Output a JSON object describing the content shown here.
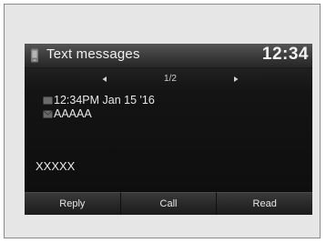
{
  "header": {
    "title": "Text messages",
    "clock": "12:34"
  },
  "pager": {
    "page": "1/2",
    "prev_icon": "arrow-left-icon",
    "next_icon": "arrow-right-icon"
  },
  "message": {
    "timestamp": "12:34PM Jan 15 '16",
    "sender": "AAAAA",
    "body": "XXXXX"
  },
  "softkeys": [
    "Reply",
    "Call",
    "Read"
  ],
  "colors": {
    "screen_bg": "#0d0d0d",
    "header_bg": "#3a3a3a",
    "text": "#e8e8e8"
  }
}
